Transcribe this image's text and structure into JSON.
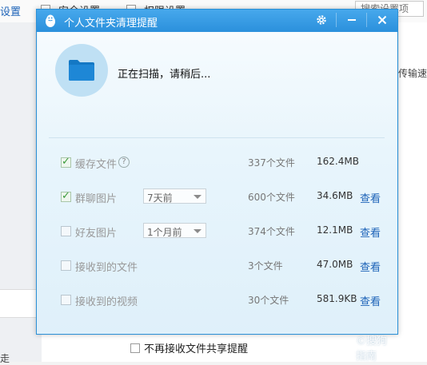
{
  "background": {
    "settings_link": "设置",
    "tabs": [
      "安全设置",
      "权限设置"
    ],
    "search_placeholder": "搜索设置项",
    "right_text": "传输速",
    "left_char": "走",
    "bottom_option_label": "不再接收文件共享提醒"
  },
  "dialog": {
    "title": "个人文件夹清理提醒",
    "scan_status": "正在扫描，请稍后...",
    "help_icon": "?",
    "colors": {
      "title_bar": "#2b90dc",
      "link": "#1d63b8",
      "folder": "#1e87d6"
    },
    "rows": [
      {
        "label": "缓存文件",
        "checked": true,
        "help": true,
        "dropdown": "",
        "count": "337个文件",
        "size": "162.4MB",
        "view": ""
      },
      {
        "label": "群聊图片",
        "checked": true,
        "help": false,
        "dropdown": "7天前",
        "count": "600个文件",
        "size": "34.6MB",
        "view": "查看"
      },
      {
        "label": "好友图片",
        "checked": false,
        "help": false,
        "dropdown": "1个月前",
        "count": "374个文件",
        "size": "12.1MB",
        "view": "查看"
      },
      {
        "label": "接收到的文件",
        "checked": false,
        "help": false,
        "dropdown": "",
        "count": "3个文件",
        "size": "47.0MB",
        "view": "查看"
      },
      {
        "label": "接收到的视频",
        "checked": false,
        "help": false,
        "dropdown": "",
        "count": "30个文件",
        "size": "581.9KB",
        "view": "查看"
      }
    ]
  },
  "watermark": "©搜狗指南"
}
